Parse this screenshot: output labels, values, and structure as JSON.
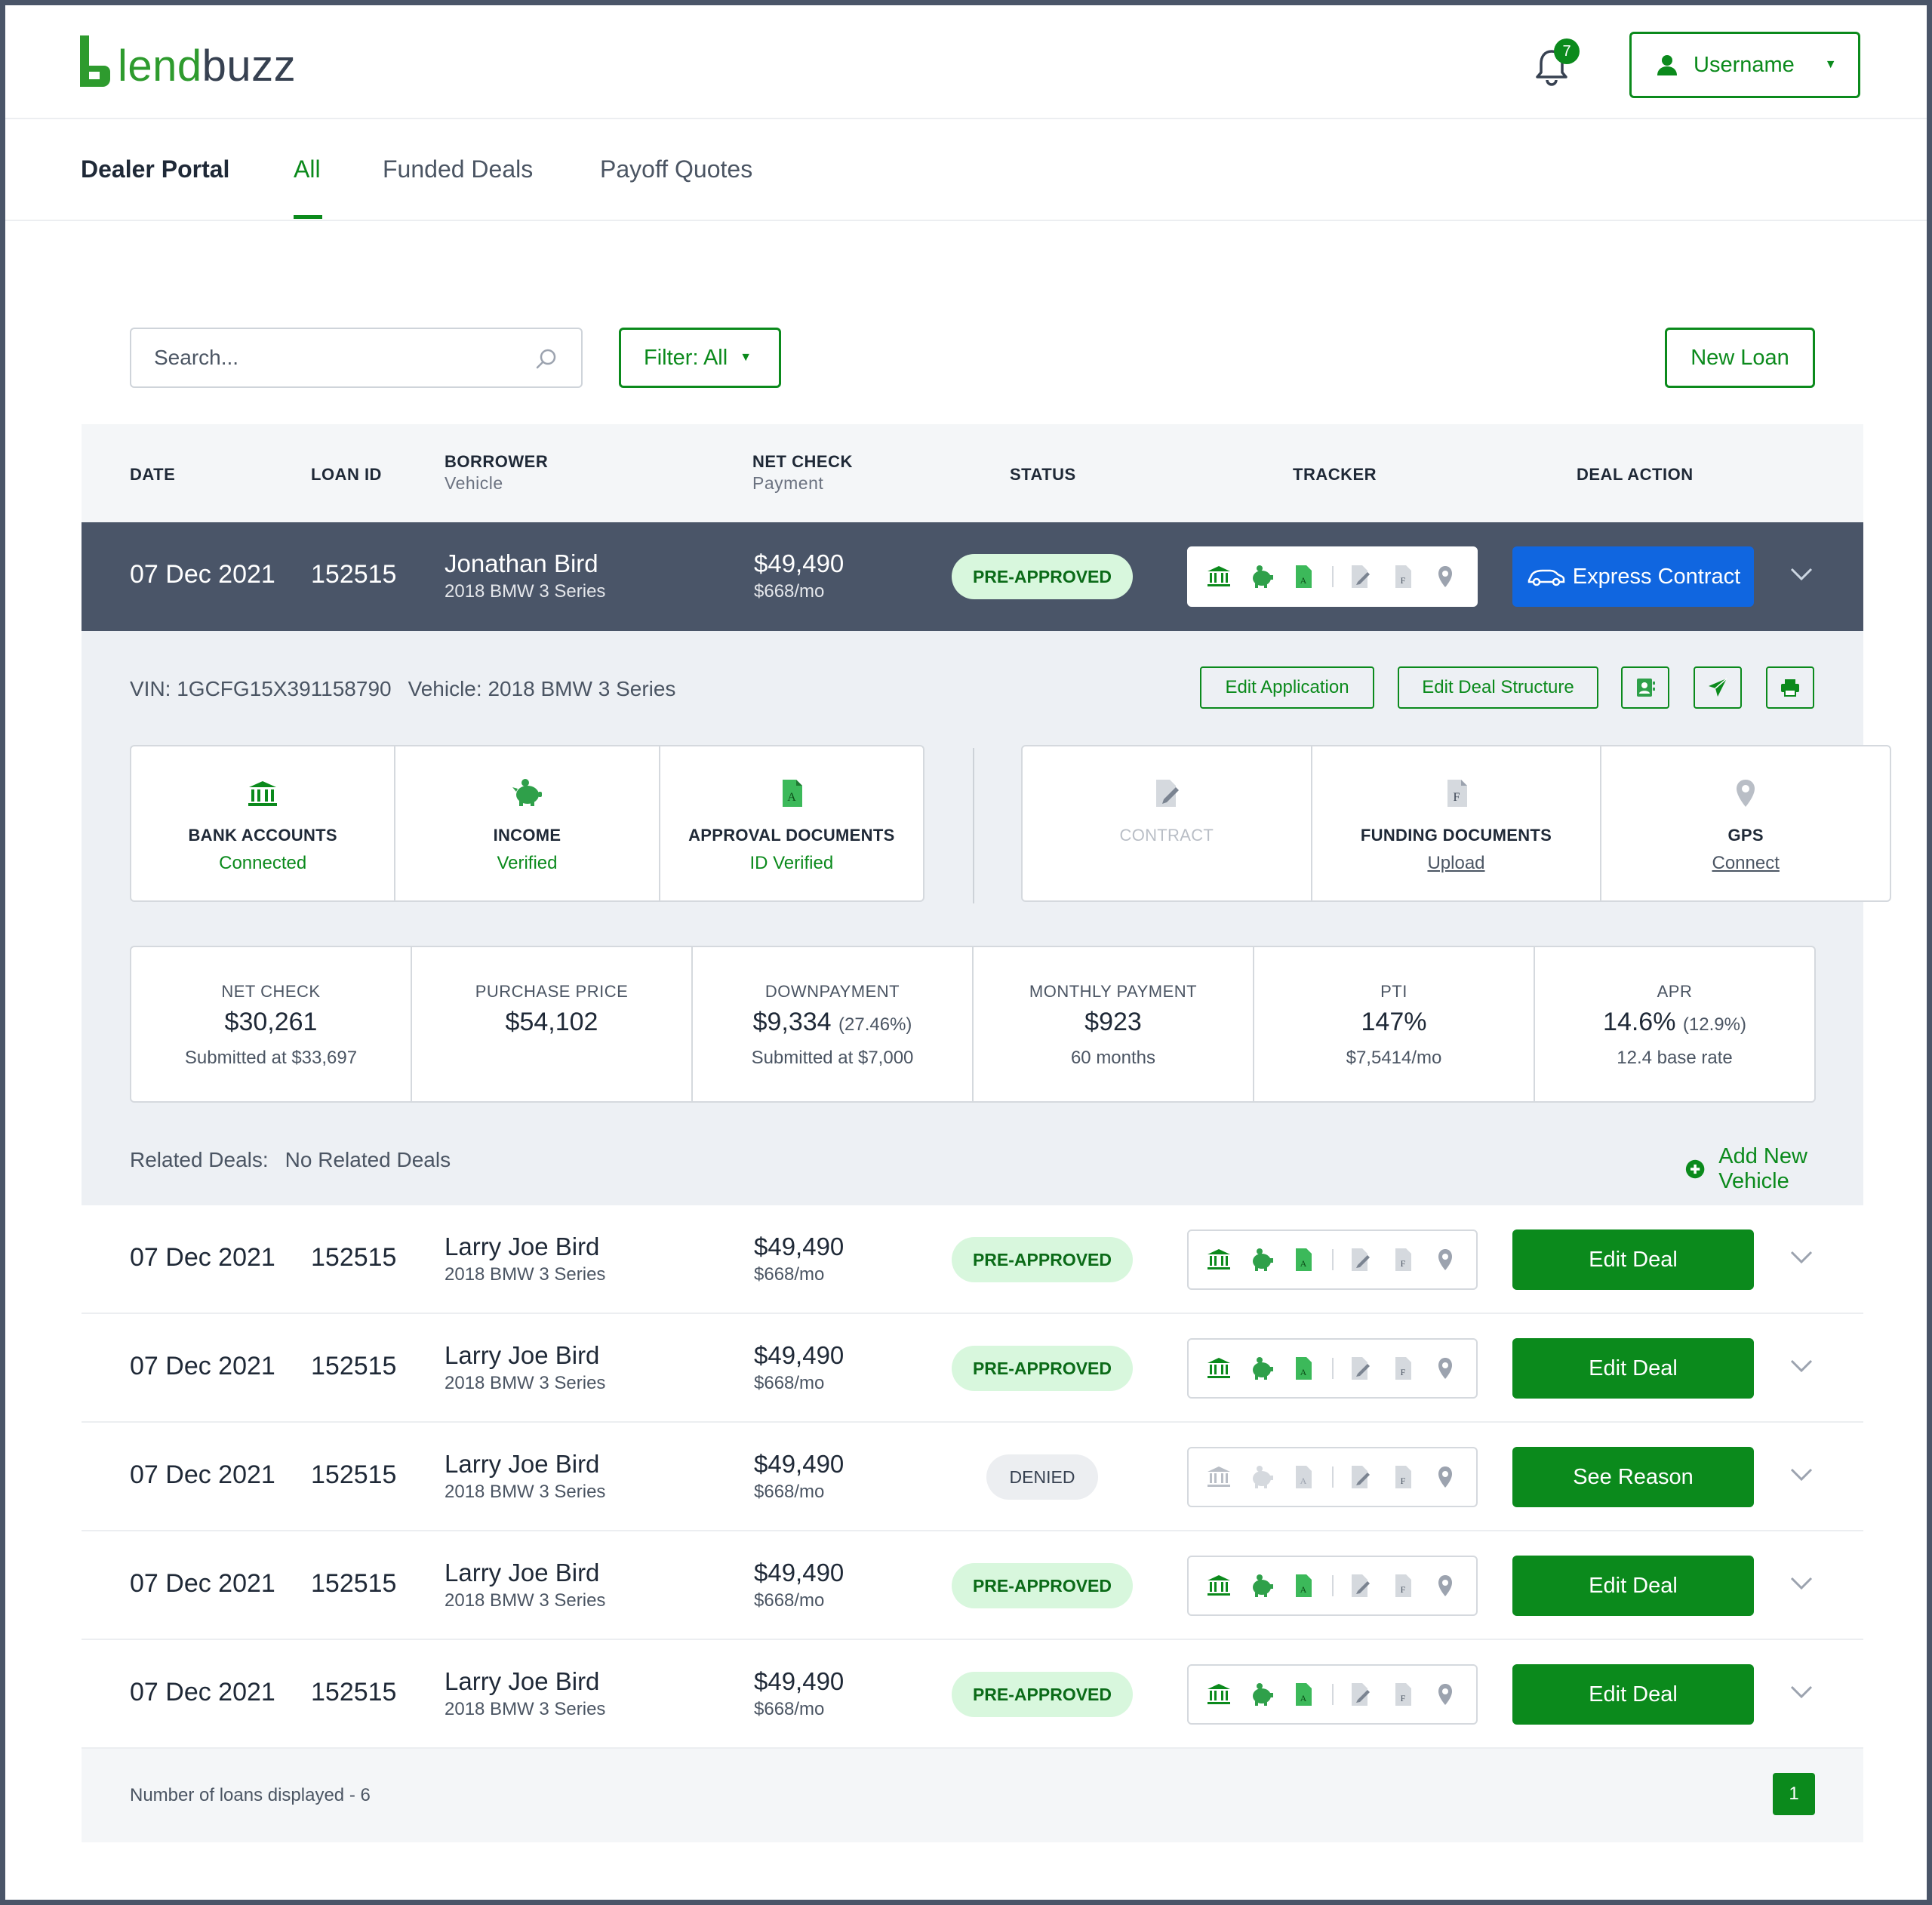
{
  "brand": {
    "logo_lend": "lend",
    "logo_buzz": "buzz"
  },
  "header": {
    "notification_count": "7",
    "username": "Username"
  },
  "nav": {
    "title": "Dealer Portal",
    "tabs": [
      "All",
      "Funded Deals",
      "Payoff Quotes"
    ],
    "active_tab": "All"
  },
  "toolbar": {
    "search_placeholder": "Search...",
    "filter_label": "Filter: All",
    "new_loan_label": "New Loan"
  },
  "table": {
    "headers": {
      "date": "DATE",
      "loan_id": "LOAN ID",
      "borrower": "BORROWER",
      "borrower_sub": "Vehicle",
      "net_check": "NET CHECK",
      "net_check_sub": "Payment",
      "status": "STATUS",
      "tracker": "TRACKER",
      "deal_action": "DEAL ACTION"
    },
    "rows": [
      {
        "date": "07 Dec 2021",
        "loan_id": "152515",
        "borrower": "Jonathan Bird",
        "vehicle": "2018 BMW 3 Series",
        "net_check": "$49,490",
        "payment": "$668/mo",
        "status": "PRE-APPROVED",
        "action": "Express Contract"
      },
      {
        "date": "07 Dec 2021",
        "loan_id": "152515",
        "borrower": "Larry Joe Bird",
        "vehicle": "2018 BMW 3 Series",
        "net_check": "$49,490",
        "payment": "$668/mo",
        "status": "PRE-APPROVED",
        "action": "Edit Deal"
      },
      {
        "date": "07 Dec 2021",
        "loan_id": "152515",
        "borrower": "Larry Joe Bird",
        "vehicle": "2018 BMW 3 Series",
        "net_check": "$49,490",
        "payment": "$668/mo",
        "status": "PRE-APPROVED",
        "action": "Edit Deal"
      },
      {
        "date": "07 Dec 2021",
        "loan_id": "152515",
        "borrower": "Larry Joe Bird",
        "vehicle": "2018 BMW 3 Series",
        "net_check": "$49,490",
        "payment": "$668/mo",
        "status": "DENIED",
        "action": "See Reason"
      },
      {
        "date": "07 Dec 2021",
        "loan_id": "152515",
        "borrower": "Larry Joe Bird",
        "vehicle": "2018 BMW 3 Series",
        "net_check": "$49,490",
        "payment": "$668/mo",
        "status": "PRE-APPROVED",
        "action": "Edit Deal"
      },
      {
        "date": "07 Dec 2021",
        "loan_id": "152515",
        "borrower": "Larry Joe Bird",
        "vehicle": "2018 BMW 3 Series",
        "net_check": "$49,490",
        "payment": "$668/mo",
        "status": "PRE-APPROVED",
        "action": "Edit Deal"
      }
    ]
  },
  "detail": {
    "vin": "VIN: 1GCFG15X391158790",
    "vehicle": "Vehicle: 2018 BMW 3 Series",
    "edit_application": "Edit Application",
    "edit_deal_structure": "Edit Deal Structure",
    "trackers": {
      "bank": {
        "label": "BANK ACCOUNTS",
        "value": "Connected"
      },
      "income": {
        "label": "INCOME",
        "value": "Verified"
      },
      "approval": {
        "label": "APPROVAL DOCUMENTS",
        "value": "ID Verified"
      },
      "contract": {
        "label": "CONTRACT",
        "value": ""
      },
      "funding": {
        "label": "FUNDING DOCUMENTS",
        "value": "Upload"
      },
      "gps": {
        "label": "GPS",
        "value": "Connect"
      }
    },
    "stats": {
      "net_check": {
        "label": "NET CHECK",
        "value": "$30,261",
        "sub": "Submitted at $33,697"
      },
      "purchase_price": {
        "label": "PURCHASE PRICE",
        "value": "$54,102",
        "sub": ""
      },
      "downpayment": {
        "label": "DOWNPAYMENT",
        "value": "$9,334",
        "paren": "(27.46%)",
        "sub": "Submitted at $7,000"
      },
      "monthly_payment": {
        "label": "MONTHLY PAYMENT",
        "value": "$923",
        "sub": "60 months"
      },
      "pti": {
        "label": "PTI",
        "value": "147%",
        "sub": "$7,5414/mo"
      },
      "apr": {
        "label": "APR",
        "value": "14.6%",
        "paren": "(12.9%)",
        "sub": "12.4 base rate"
      }
    },
    "related_label": "Related Deals:",
    "related_value": "No Related Deals",
    "add_vehicle": "Add New Vehicle"
  },
  "footer": {
    "count_text": "Number of loans displayed - 6",
    "page": "1"
  },
  "colors": {
    "brand_green": "#0b8a1c",
    "logo_green": "#2e9b2e",
    "express_blue": "#1066e0",
    "active_row": "#4a5568",
    "status_bg": "#d8f7dd"
  }
}
